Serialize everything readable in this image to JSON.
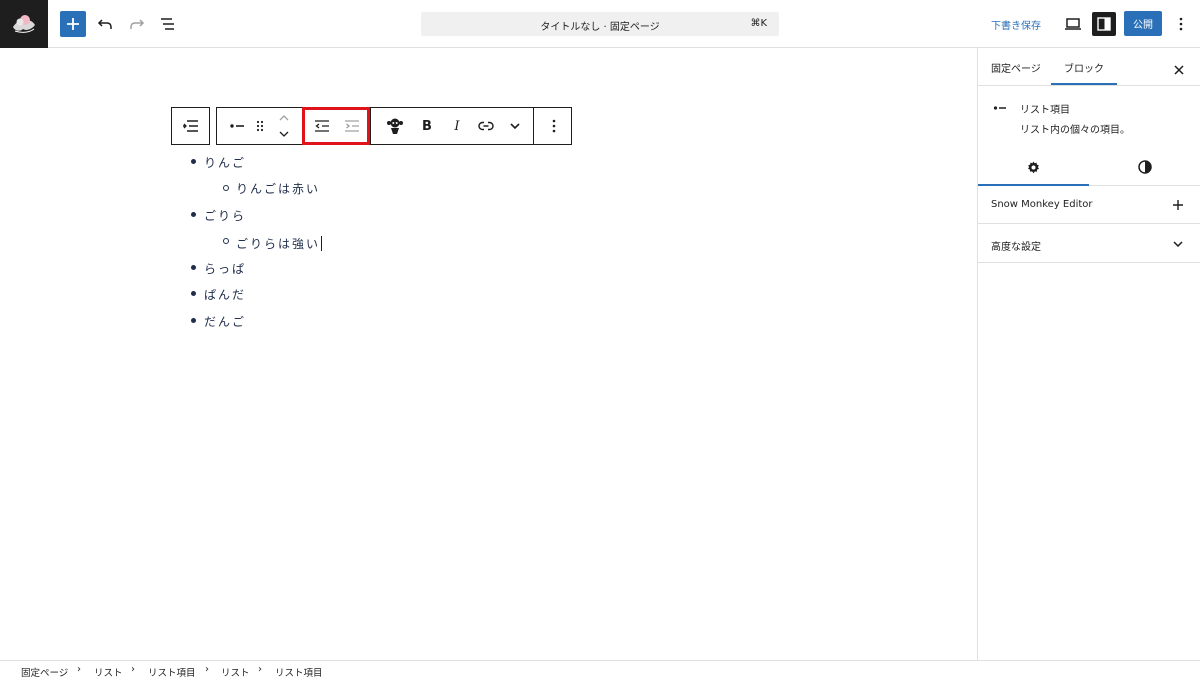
{
  "header": {
    "document_title": "タイトルなし · 固定ページ",
    "shortcut": "⌘K",
    "save_draft": "下書き保存",
    "publish": "公開"
  },
  "list_items": [
    {
      "text": "りんご",
      "level": 1
    },
    {
      "text": "りんごは赤い",
      "level": 2
    },
    {
      "text": "ごりら",
      "level": 1
    },
    {
      "text": "ごりらは強い",
      "level": 2
    },
    {
      "text": "らっぱ",
      "level": 1
    },
    {
      "text": "ぱんだ",
      "level": 1
    },
    {
      "text": "だんご",
      "level": 1
    }
  ],
  "sidebar": {
    "tab_page": "固定ページ",
    "tab_block": "ブロック",
    "block_name": "リスト項目",
    "block_description": "リスト内の個々の項目。",
    "panel_snow_monkey": "Snow Monkey Editor",
    "panel_advanced": "高度な設定"
  },
  "breadcrumb": [
    "固定ページ",
    "リスト",
    "リスト項目",
    "リスト",
    "リスト項目"
  ],
  "colors": {
    "accent": "#2a70b8",
    "highlight": "#e0131a",
    "text": "#1f2d4a"
  }
}
